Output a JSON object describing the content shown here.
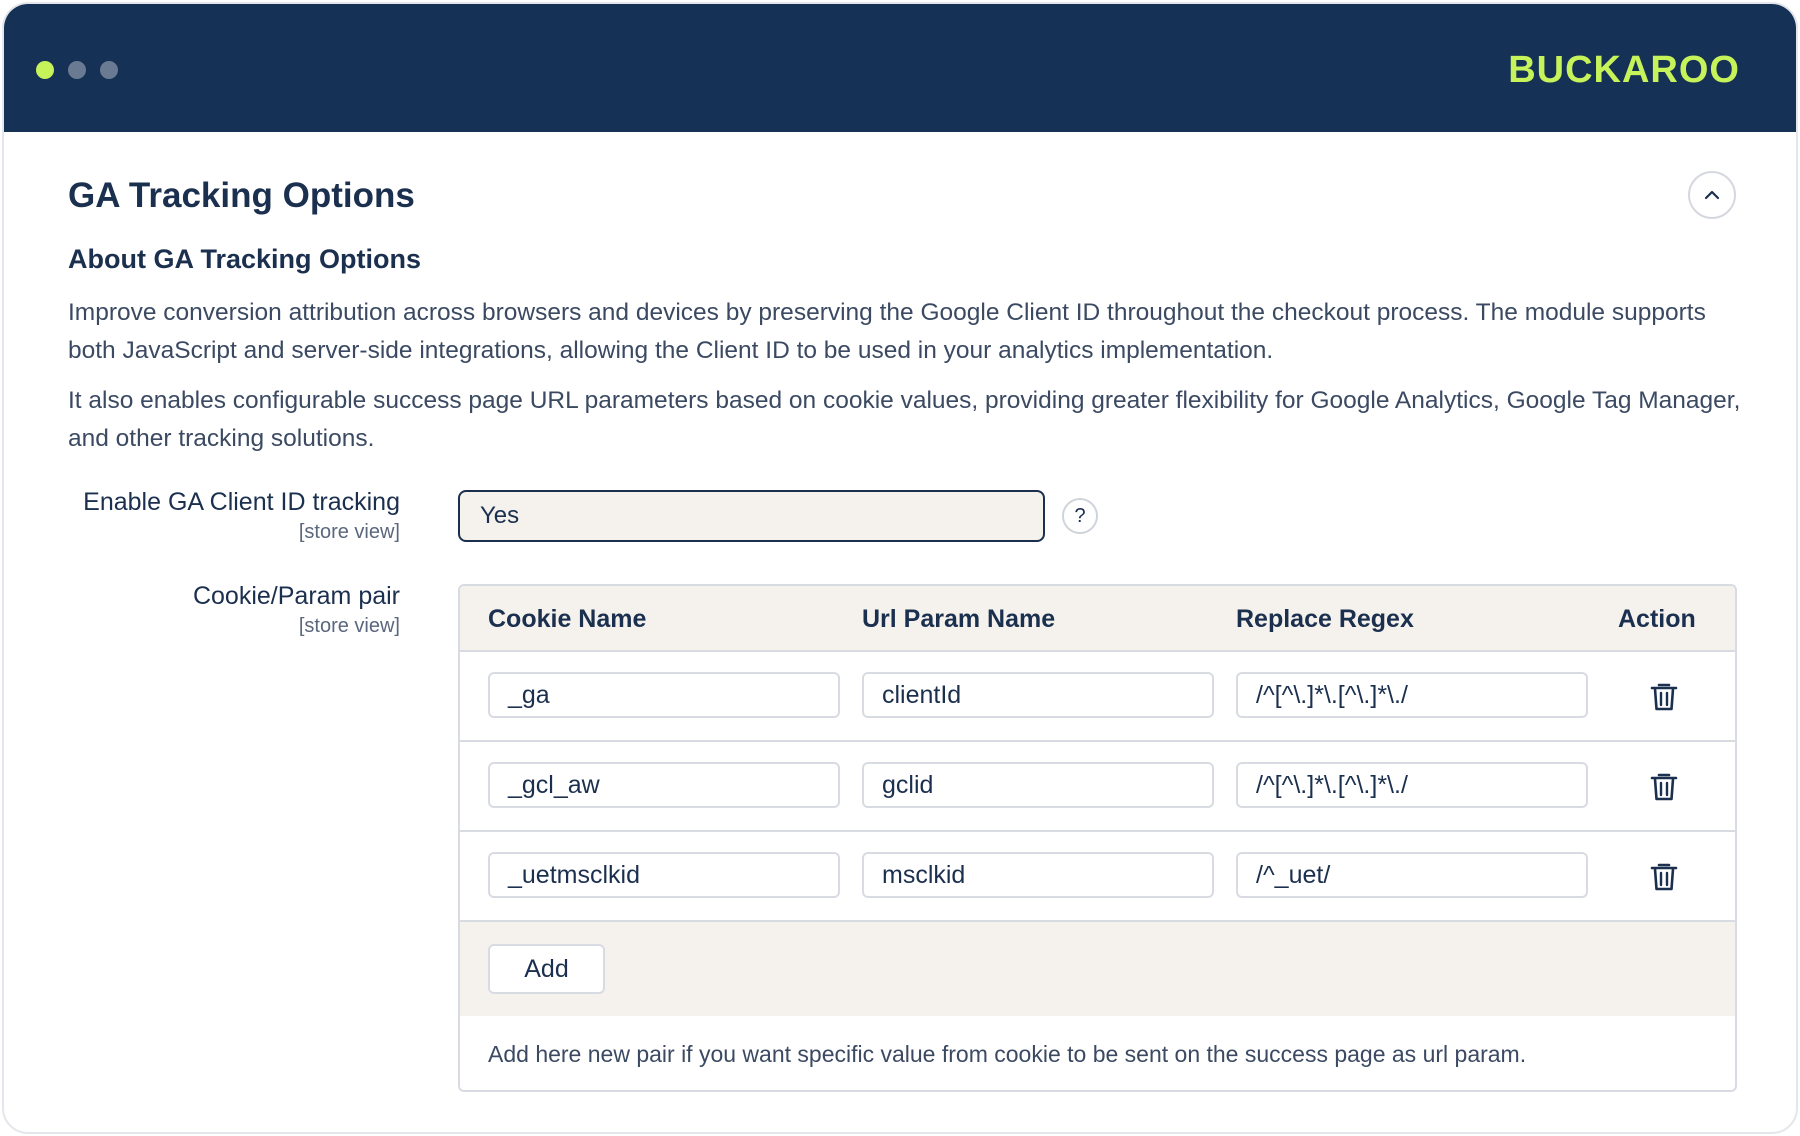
{
  "window": {
    "brand": "BUCKAROO",
    "colors": {
      "header_bg": "#163156",
      "accent": "#c6f25a",
      "text": "#1b2f4e",
      "row_header_bg": "#f5f2ee"
    }
  },
  "section": {
    "title": "GA Tracking Options",
    "collapse_icon": "chevron-up-icon",
    "about_title": "About GA Tracking Options",
    "paragraphs": [
      "Improve conversion attribution across browsers and devices by preserving the Google Client ID throughout the checkout process. The module supports both JavaScript and server-side integrations, allowing the Client ID to be used in your analytics implementation.",
      "It also enables configurable success page URL parameters based on cookie values, providing greater flexibility for Google Analytics, Google Tag Manager, and other tracking solutions."
    ]
  },
  "fields": {
    "enable": {
      "label": "Enable GA Client ID tracking",
      "scope": "[store view]",
      "value": "Yes",
      "help": "?"
    },
    "pairs": {
      "label": "Cookie/Param pair",
      "scope": "[store view]",
      "columns": [
        "Cookie Name",
        "Url Param Name",
        "Replace Regex",
        "Action"
      ],
      "rows": [
        {
          "cookie": "_ga",
          "param": "clientId",
          "regex": "/^[^\\.]*\\.[^\\.]*\\./"
        },
        {
          "cookie": "_gcl_aw",
          "param": "gclid",
          "regex": "/^[^\\.]*\\.[^\\.]*\\./"
        },
        {
          "cookie": "_uetmsclkid",
          "param": "msclkid",
          "regex": "/^_uet/"
        }
      ],
      "delete_icon": "trash-icon",
      "add_label": "Add",
      "note": "Add here new pair if you want specific value from cookie to be sent on the success page as url param."
    }
  }
}
